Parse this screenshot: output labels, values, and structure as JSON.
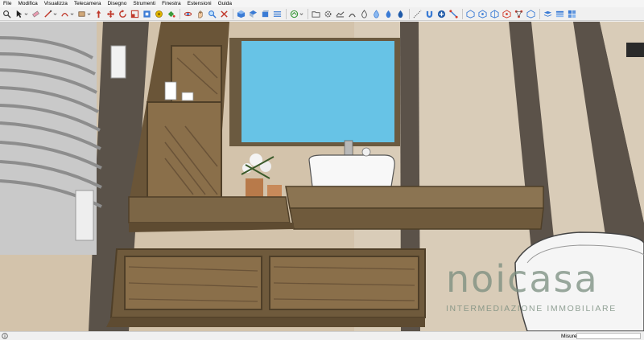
{
  "menu": {
    "items": [
      "File",
      "Modifica",
      "Visualizza",
      "Telecamera",
      "Disegno",
      "Strumenti",
      "Finestra",
      "Estensioni",
      "Guida"
    ]
  },
  "toolbar": {
    "tools": [
      "zoom-icon",
      "select-arrow-icon",
      "eraser-icon",
      "line-icon",
      "arc-icon",
      "rectangle-icon",
      "push-pull-icon",
      "move-icon",
      "rotate-icon",
      "scale-icon",
      "offset-icon",
      "tape-measure-icon",
      "paint-bucket-icon",
      "orbit-icon",
      "pan-icon",
      "zoom-tool-icon",
      "zoom-extents-icon",
      "iso-view-icon",
      "top-view-icon",
      "front-view-icon",
      "section-icon",
      "component-icon",
      "folder-icon",
      "settings-icon",
      "sandbox-icon",
      "drape-icon",
      "water-drop-icon",
      "magnet-icon",
      "point-icon",
      "plus-icon",
      "flip-icon",
      "solid-icon",
      "hexagon-icon",
      "hexagon-outline-icon",
      "shell-icon",
      "network-icon",
      "layers-icon",
      "layers-stack-icon",
      "layers-grid-icon"
    ],
    "colors": {
      "blue": "#3a7bd5",
      "red": "#d33a2c",
      "green": "#3b9a3b",
      "yellow": "#e0b400",
      "gray": "#555555"
    }
  },
  "watermark": {
    "logo": "noicasa",
    "tagline": "INTERMEDIAZIONE IMMOBILIARE"
  },
  "status": {
    "measure_label": "Misure",
    "measure_value": ""
  }
}
